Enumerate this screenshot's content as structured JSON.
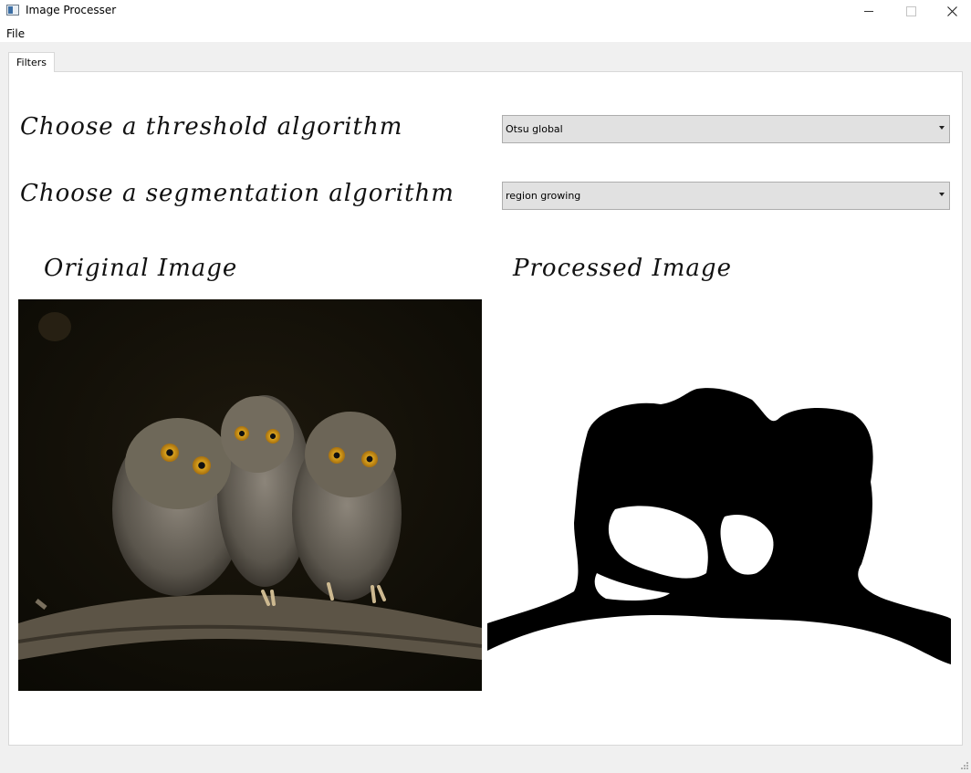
{
  "window": {
    "title": "Image Processer"
  },
  "menubar": {
    "items": [
      "File"
    ]
  },
  "tabs": [
    {
      "label": "Filters",
      "active": true
    }
  ],
  "threshold": {
    "label": "Choose a threshold algorithm",
    "selected": "Otsu global"
  },
  "segmentation": {
    "label": "Choose a segmentation algorithm",
    "selected": "region growing"
  },
  "images": {
    "original_label": "Original Image",
    "processed_label": "Processed Image"
  },
  "colors": {
    "panel_bg": "#ffffff",
    "window_bg": "#f0f0f0",
    "combo_bg": "#e1e1e1"
  },
  "icons": [
    "app-icon",
    "minimize-icon",
    "maximize-icon",
    "close-icon",
    "dropdown-arrow-icon",
    "resize-grip-icon"
  ]
}
